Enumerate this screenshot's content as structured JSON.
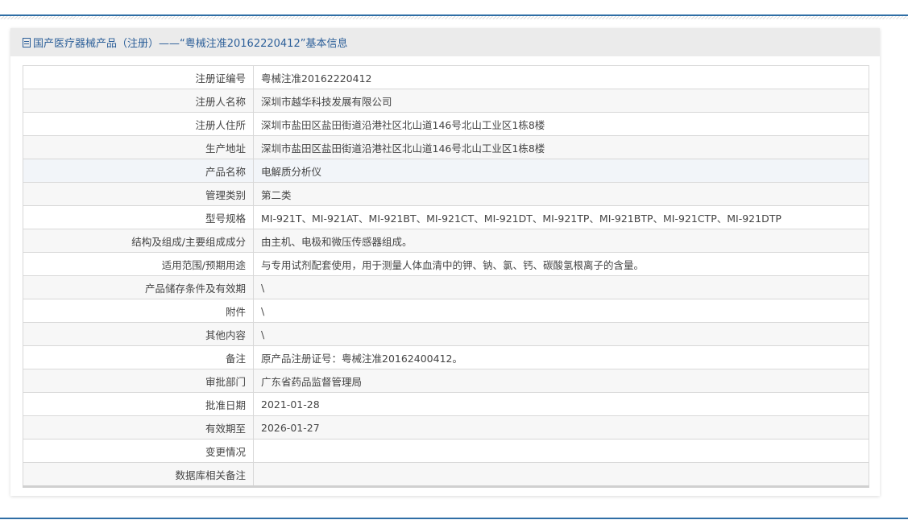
{
  "title": "国产医疗器械产品（注册）——“粤械注准20162220412”基本信息",
  "rows": [
    {
      "label": "注册证编号",
      "value": "粤械注准20162220412"
    },
    {
      "label": "注册人名称",
      "value": "深圳市越华科技发展有限公司"
    },
    {
      "label": "注册人住所",
      "value": "深圳市盐田区盐田街道沿港社区北山道146号北山工业区1栋8楼"
    },
    {
      "label": "生产地址",
      "value": "深圳市盐田区盐田街道沿港社区北山道146号北山工业区1栋8楼"
    },
    {
      "label": "产品名称",
      "value": "电解质分析仪"
    },
    {
      "label": "管理类别",
      "value": "第二类"
    },
    {
      "label": "型号规格",
      "value": "MI-921T、MI-921AT、MI-921BT、MI-921CT、MI-921DT、MI-921TP、MI-921BTP、MI-921CTP、MI-921DTP"
    },
    {
      "label": "结构及组成/主要组成成分",
      "value": "由主机、电极和微压传感器组成。"
    },
    {
      "label": "适用范围/预期用途",
      "value": "与专用试剂配套使用，用于测量人体血清中的钾、钠、氯、钙、碳酸氢根离子的含量。"
    },
    {
      "label": "产品储存条件及有效期",
      "value": "\\"
    },
    {
      "label": "附件",
      "value": "\\"
    },
    {
      "label": "其他内容",
      "value": "\\"
    },
    {
      "label": "备注",
      "value": "原产品注册证号：粤械注准20162400412。"
    },
    {
      "label": "审批部门",
      "value": "广东省药品监督管理局"
    },
    {
      "label": "批准日期",
      "value": "2021-01-28"
    },
    {
      "label": "有效期至",
      "value": "2026-01-27"
    },
    {
      "label": "变更情况",
      "value": ""
    },
    {
      "label": "数据库相关备注",
      "value": ""
    }
  ]
}
